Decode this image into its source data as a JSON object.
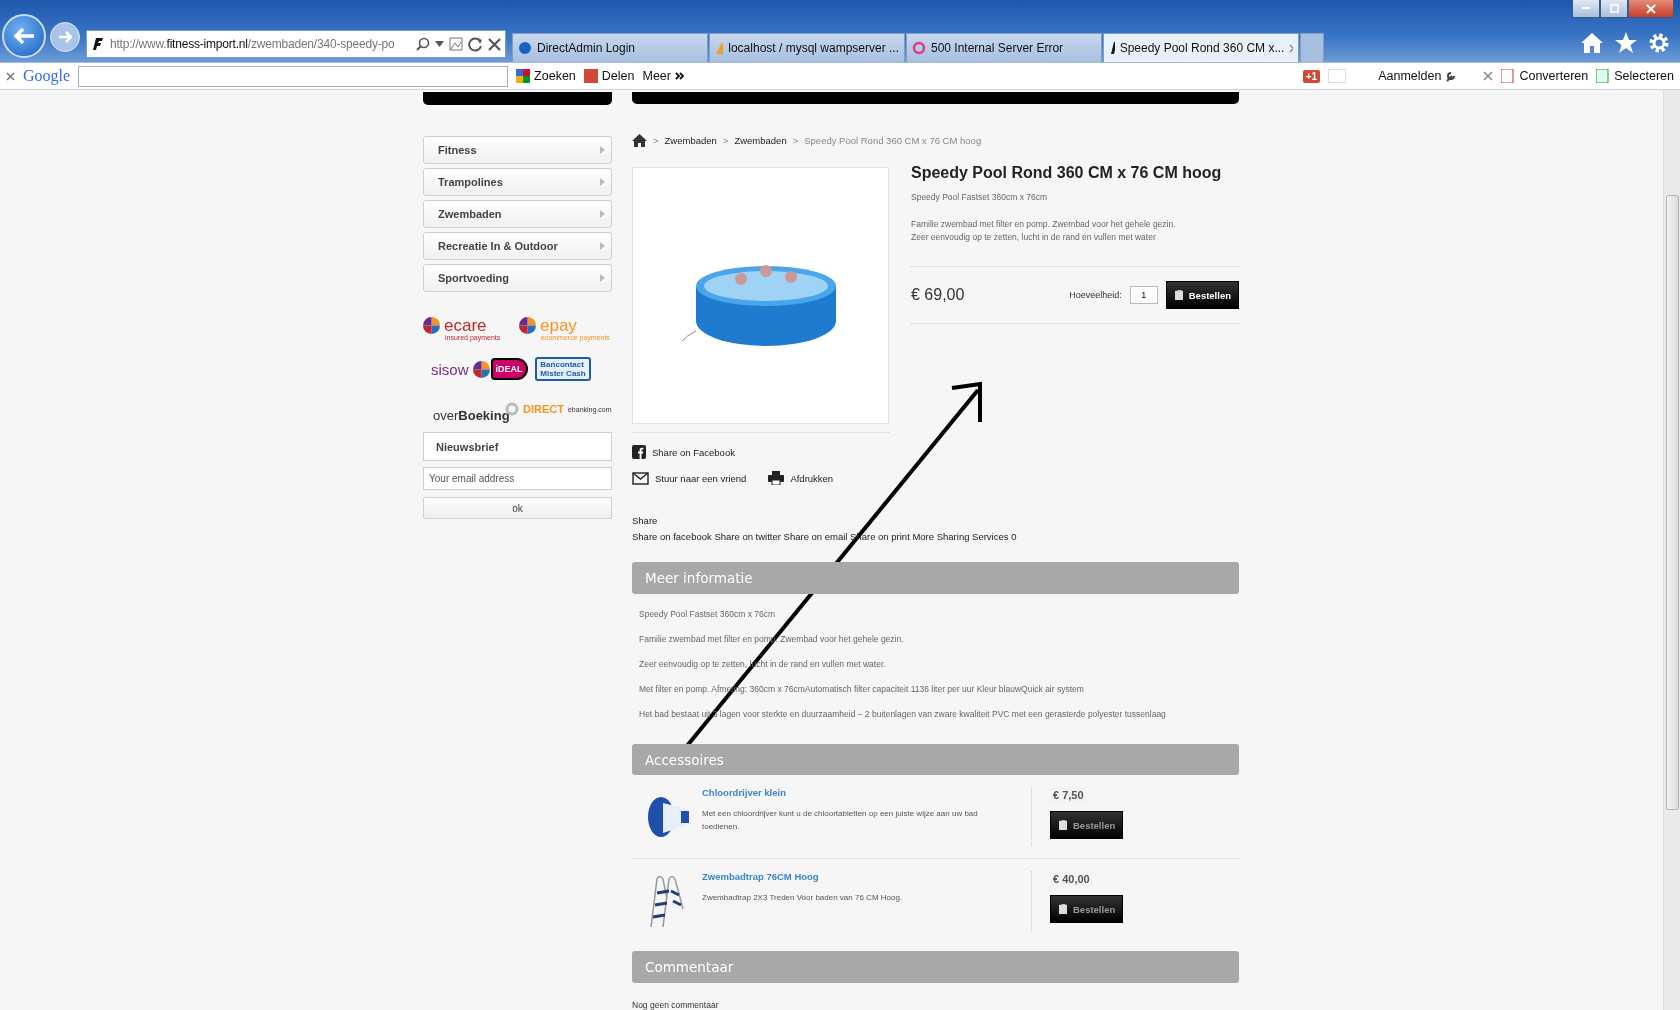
{
  "browser": {
    "address_host": "http://www.",
    "address_domain": "fitness-import.nl",
    "address_path": "/zwembaden/340-speedy-po",
    "tabs": [
      {
        "title": "DirectAdmin Login",
        "kind": "circle",
        "selected": false
      },
      {
        "title": "localhost / mysql wampserver ...",
        "kind": "pma",
        "selected": false
      },
      {
        "title": "500 Internal Server Error",
        "kind": "wamp",
        "selected": false
      },
      {
        "title": "Speedy Pool Rond 360 CM x...",
        "kind": "fi",
        "selected": true
      }
    ]
  },
  "toolbar": {
    "brand": "Google",
    "search": "Zoeken",
    "share": "Delen",
    "more": "Meer",
    "plus_one": "+1",
    "signin": "Aanmelden",
    "convert": "Converteren",
    "select": "Selecteren"
  },
  "sidebar": {
    "categories": [
      "Fitness",
      "Trampolines",
      "Zwembaden",
      "Recreatie In & Outdoor",
      "Sportvoeding"
    ],
    "payment_logos": [
      {
        "kind": "ecare",
        "text": "ecare",
        "tagline": "insured payments"
      },
      {
        "kind": "epay",
        "text": "epay",
        "tagline": "ecommerce payments"
      },
      {
        "kind": "sisow",
        "text": "sisow"
      },
      {
        "kind": "ideal",
        "text": "iDEAL"
      },
      {
        "kind": "bancontact",
        "text": "Bancontact",
        "tagline": "Mister Cash"
      },
      {
        "kind": "overboeking",
        "text": "over**Boeking**"
      },
      {
        "kind": "direct",
        "text": "DIRECT",
        "tagline": "ebanking.com"
      }
    ],
    "newsletter": {
      "title": "Nieuwsbrief",
      "placeholder": "Your email address",
      "button": "ok"
    }
  },
  "breadcrumb": [
    {
      "separator": ">",
      "label": "Zwembaden",
      "link": true
    },
    {
      "separator": ">",
      "label": "Zwembaden",
      "link": true
    },
    {
      "separator": ">",
      "label": "Speedy Pool Rond 360 CM x 76 CM hoog",
      "link": false
    }
  ],
  "product": {
    "title": "Speedy Pool Rond 360 CM x 76 CM hoog",
    "subtitle": "Speedy Pool Fastset 360cm x 76cm",
    "description": [
      "Familie zwembad met filter en pomp. Zwembad voor het gehele gezin.",
      "Zeer eenvoudig op te zetten, lucht in de rand en vullen met water"
    ],
    "price": "€ 69,00",
    "quantity_label": "Hoeveelheid:",
    "quantity": "1",
    "order_button": "Bestellen"
  },
  "actions": [
    {
      "kind": "facebook",
      "label": "Share on Facebook"
    },
    {
      "kind": "mail",
      "label": "Stuur naar een vriend"
    },
    {
      "kind": "print",
      "label": "Afdrukken"
    }
  ],
  "share": {
    "title": "Share",
    "line": "Share on facebook Share on twitter Share on email Share on print More Sharing Services 0"
  },
  "more_info": {
    "title": "Meer informatie",
    "lines": [
      "Speedy Pool Fastset 360cm x 76cm",
      "Familie zwembad met filter en pomp. Zwembad voor het gehele gezin.",
      "Zeer eenvoudig op te zetten, lucht in de rand en vullen met water.",
      "Met filter en pomp. Afmeting: 360cm x 76cmAutomatisch filter capaciteit 1136 liter per uur Kleur blauwQuick air system",
      "Het bad bestaat uit 3 lagen voor sterkte en duurzaamheid – 2 buitenlagen van zware kwaliteit PVC met een gerasterde polyester tussenlaag"
    ]
  },
  "accessories": {
    "title": "Accessoires",
    "items": [
      {
        "kind": "floater",
        "name": "Chloordrijver klein",
        "description": "Met een chloordrijver kunt u de chloortabletten op een juiste wijze aan uw bad toedienen.",
        "price": "€ 7,50",
        "button": "Bestellen"
      },
      {
        "kind": "ladder",
        "name": "Zwembadtrap 76CM Hoog",
        "description": "Zwembadtrap 2X3 Treden Voor baden van 76 CM Hoog.",
        "price": "€ 40,00",
        "button": "Bestellen"
      }
    ]
  },
  "comments": {
    "title": "Commentaar",
    "empty": "Nog geen commentaar"
  }
}
